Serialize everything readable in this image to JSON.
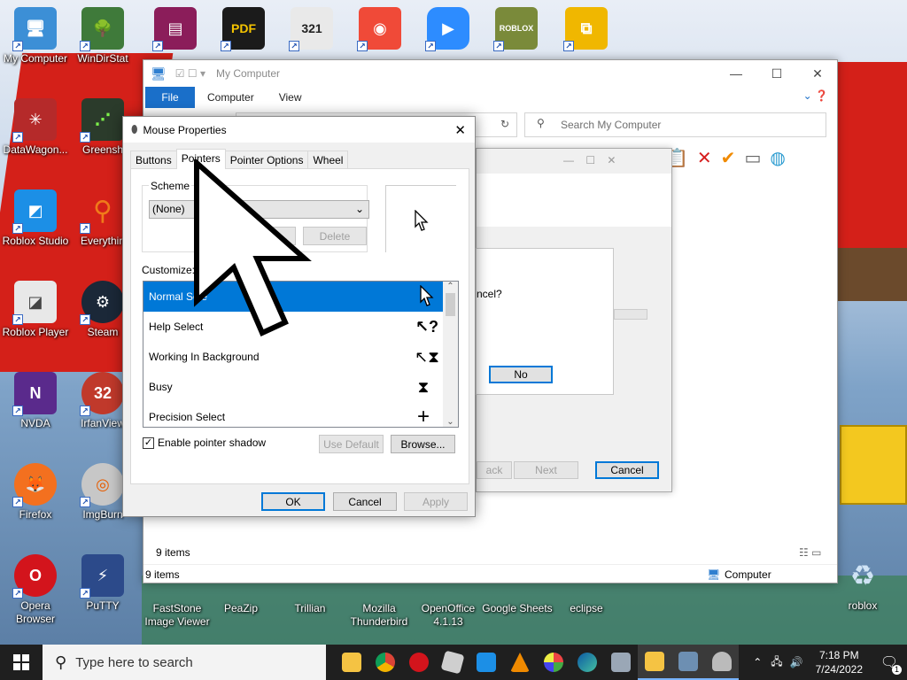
{
  "colors": {
    "accent": "#0078d7",
    "taskbar": "#1f1f1f",
    "selection": "#0078d7",
    "explorer_file_tab": "#1a6fc9",
    "wallpaper_red": "#d42019"
  },
  "desktop": {
    "icons": [
      {
        "label": "My Computer",
        "icon": "computer-icon"
      },
      {
        "label": "WinDirStat",
        "icon": "tree-icon"
      },
      {
        "label": "DataWagon...",
        "icon": "datawagon-icon"
      },
      {
        "label": "Greensh",
        "icon": "greenshot-icon"
      },
      {
        "label": "Roblox Studio",
        "icon": "roblox-studio-icon"
      },
      {
        "label": "Everythin",
        "icon": "everything-search-icon"
      },
      {
        "label": "Roblox Player",
        "icon": "roblox-player-icon"
      },
      {
        "label": "Steam",
        "icon": "steam-icon"
      },
      {
        "label": "NVDA",
        "icon": "nvda-icon"
      },
      {
        "label": "IrfanView",
        "icon": "irfanview-icon"
      },
      {
        "label": "Firefox",
        "icon": "firefox-icon"
      },
      {
        "label": "ImgBurn",
        "icon": "imgburn-icon"
      },
      {
        "label": "Opera Browser",
        "icon": "opera-icon"
      },
      {
        "label": "PuTTY",
        "icon": "putty-icon"
      },
      {
        "label": "FastStone Image Viewer",
        "icon": "faststone-icon"
      },
      {
        "label": "PeaZip",
        "icon": "peazip-icon"
      },
      {
        "label": "Trillian",
        "icon": "trillian-icon"
      },
      {
        "label": "Mozilla Thunderbird",
        "icon": "thunderbird-icon"
      },
      {
        "label": "OpenOffice 4.1.13",
        "icon": "openoffice-icon"
      },
      {
        "label": "Google Sheets",
        "icon": "google-sheets-icon"
      },
      {
        "label": "eclipse",
        "icon": "eclipse-icon"
      },
      {
        "label": "roblox",
        "icon": "recycle-bin-icon"
      }
    ],
    "top_row_icons": [
      "winrar-icon",
      "pdf-icon",
      "media-player-classic-icon",
      "screen-recorder-icon",
      "zoom-icon",
      "roblox-game-icon",
      "duplicate-icon"
    ]
  },
  "explorer": {
    "title": "My Computer",
    "ribbon_tabs": [
      "File",
      "Computer",
      "View"
    ],
    "search_placeholder": "Search My Computer",
    "items_count_inner": "9 items",
    "items_count_status": "9 items",
    "status_location": "Computer"
  },
  "wizard": {
    "question_fragment": "ncel?",
    "no_label": "No",
    "back_label": "ack",
    "next_label": "Next",
    "cancel_label": "Cancel"
  },
  "mouse_properties": {
    "title": "Mouse Properties",
    "tabs": [
      "Buttons",
      "Pointers",
      "Pointer Options",
      "Wheel"
    ],
    "active_tab": "Pointers",
    "scheme_label": "Scheme",
    "scheme_value": "(None)",
    "save_as_label": "s...",
    "delete_label": "Delete",
    "customize_label": "Customize:",
    "pointers": [
      {
        "name": "Normal Sele",
        "icon": "arrow-cursor-icon",
        "selected": true
      },
      {
        "name": "Help Select",
        "icon": "help-cursor-icon",
        "selected": false
      },
      {
        "name": "Working In Background",
        "icon": "working-cursor-icon",
        "selected": false
      },
      {
        "name": "Busy",
        "icon": "hourglass-icon",
        "selected": false
      },
      {
        "name": "Precision Select",
        "icon": "crosshair-icon",
        "selected": false
      }
    ],
    "enable_shadow_label": "Enable pointer shadow",
    "enable_shadow_checked": true,
    "use_default_label": "Use Default",
    "browse_label": "Browse...",
    "ok_label": "OK",
    "cancel_label": "Cancel",
    "apply_label": "Apply"
  },
  "taskbar": {
    "search_placeholder": "Type here to search",
    "time": "7:18 PM",
    "date": "7/24/2022",
    "notification_count": "1"
  }
}
